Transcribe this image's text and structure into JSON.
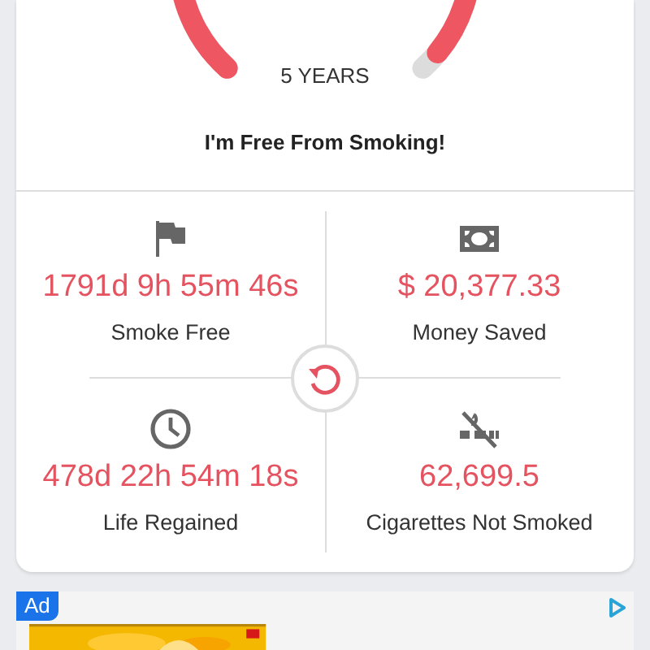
{
  "gauge": {
    "label": "5 YEARS"
  },
  "headline": "I'm Free From Smoking!",
  "stats": [
    {
      "value": "1791d 9h 55m 46s",
      "label": "Smoke Free"
    },
    {
      "value": "$ 20,377.33",
      "label": "Money Saved"
    },
    {
      "value": "478d 22h 54m 18s",
      "label": "Life Regained"
    },
    {
      "value": "62,699.5",
      "label": "Cigarettes Not Smoked"
    }
  ],
  "ad": {
    "badge": "Ad",
    "kind": "picture"
  }
}
